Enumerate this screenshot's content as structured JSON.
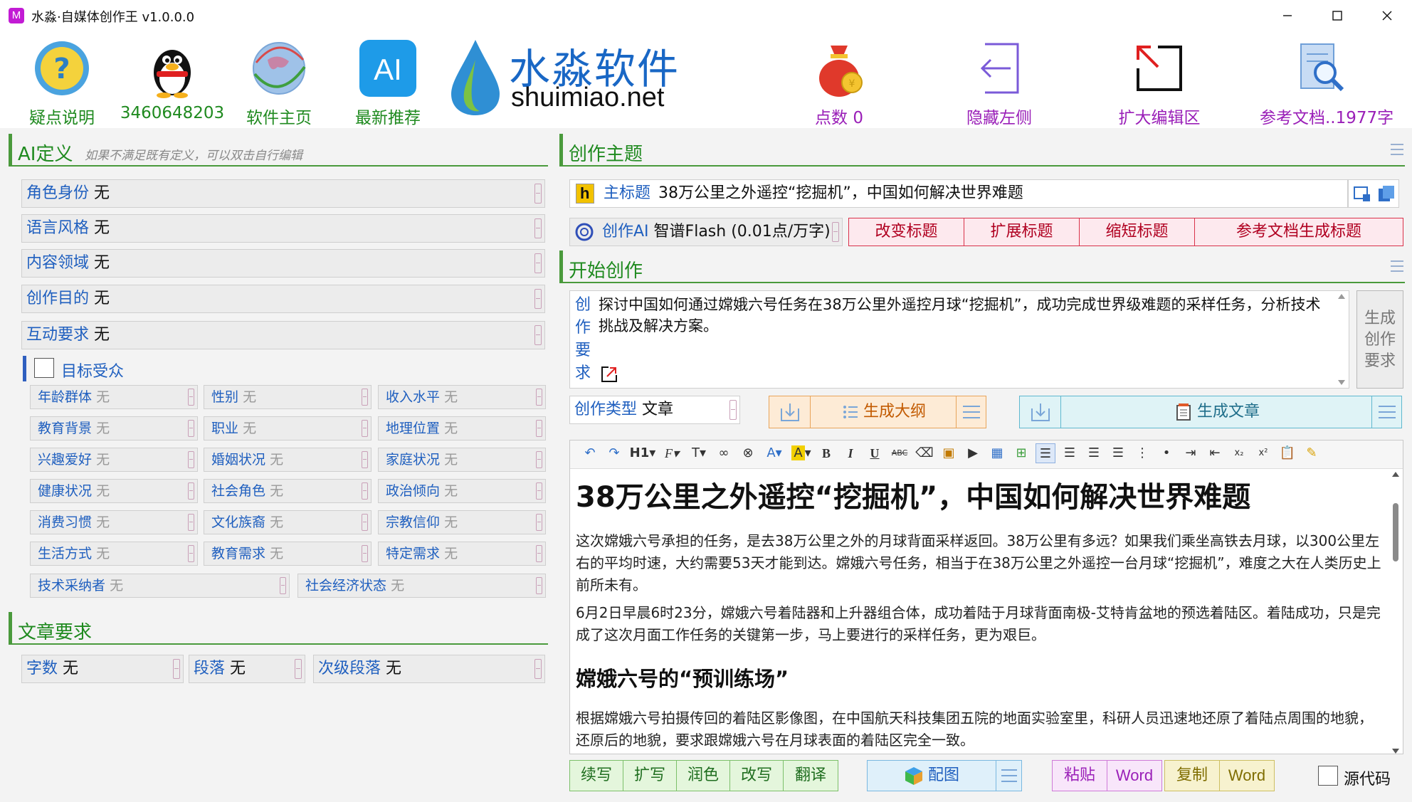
{
  "window": {
    "title": "水淼·自媒体创作王 v1.0.0.0",
    "icon_letter": "M"
  },
  "toolbar": {
    "faq": "疑点说明",
    "qq": "3460648203",
    "homepage": "软件主页",
    "ai_recommend": "最新推荐",
    "ai_icon_text": "AI",
    "logo_cn": "水淼软件",
    "logo_en": "shuimiao.net",
    "points": "点数 0",
    "hide_left": "隐藏左侧",
    "expand_editor": "扩大编辑区",
    "ref_docs": "参考文档..1977字"
  },
  "ai_def": {
    "title": "AI定义",
    "hint": "如果不满足既有定义，可以双击自行编辑",
    "fields": [
      {
        "k": "角色身份",
        "v": "无"
      },
      {
        "k": "语言风格",
        "v": "无"
      },
      {
        "k": "内容领域",
        "v": "无"
      },
      {
        "k": "创作目的",
        "v": "无"
      },
      {
        "k": "互动要求",
        "v": "无"
      }
    ],
    "audience_label": "目标受众",
    "audience": [
      {
        "k": "年龄群体",
        "v": "无"
      },
      {
        "k": "性别",
        "v": "无"
      },
      {
        "k": "收入水平",
        "v": "无"
      },
      {
        "k": "教育背景",
        "v": "无"
      },
      {
        "k": "职业",
        "v": "无"
      },
      {
        "k": "地理位置",
        "v": "无"
      },
      {
        "k": "兴趣爱好",
        "v": "无"
      },
      {
        "k": "婚姻状况",
        "v": "无"
      },
      {
        "k": "家庭状况",
        "v": "无"
      },
      {
        "k": "健康状况",
        "v": "无"
      },
      {
        "k": "社会角色",
        "v": "无"
      },
      {
        "k": "政治倾向",
        "v": "无"
      },
      {
        "k": "消费习惯",
        "v": "无"
      },
      {
        "k": "文化族裔",
        "v": "无"
      },
      {
        "k": "宗教信仰",
        "v": "无"
      },
      {
        "k": "生活方式",
        "v": "无"
      },
      {
        "k": "教育需求",
        "v": "无"
      },
      {
        "k": "特定需求",
        "v": "无"
      },
      {
        "k": "技术采纳者",
        "v": "无"
      },
      {
        "k": "社会经济状态",
        "v": "无"
      }
    ]
  },
  "article_req": {
    "title": "文章要求",
    "fields": [
      {
        "k": "字数",
        "v": "无"
      },
      {
        "k": "段落",
        "v": "无"
      },
      {
        "k": "次级段落",
        "v": "无"
      }
    ]
  },
  "topic": {
    "title": "创作主题",
    "main_title_label": "主标题",
    "main_title_value": "38万公里之外遥控“挖掘机”，中国如何解决世界难题",
    "ai_label": "创作AI",
    "ai_value": "智谱Flash (0.01点/万字)",
    "buttons": [
      "改变标题",
      "扩展标题",
      "缩短标题",
      "参考文档生成标题"
    ]
  },
  "create": {
    "title": "开始创作",
    "req_label": [
      "创",
      "作",
      "要",
      "求"
    ],
    "req_text": "探讨中国如何通过嫦娥六号任务在38万公里外遥控月球“挖掘机”，成功完成世界级难题的采样任务，分析技术挑战及解决方案。",
    "gen_req": [
      "生成",
      "创作",
      "要求"
    ],
    "type_label": "创作类型",
    "type_value": "文章",
    "outline_btn": "生成大纲",
    "article_btn": "生成文章"
  },
  "editor": {
    "toolbar": {
      "h1": "H1",
      "font": "F",
      "size": "T",
      "bold": "B",
      "italic": "I",
      "underline": "U",
      "strike": "ABC"
    },
    "h1": "38万公里之外遥控“挖掘机”，中国如何解决世界难题",
    "p1": "这次嫦娥六号承担的任务，是去38万公里之外的月球背面采样返回。38万公里有多远？如果我们乘坐高铁去月球，以300公里左右的平均时速，大约需要53天才能到达。嫦娥六号任务，相当于在38万公里之外遥控一台月球“挖掘机”，难度之大在人类历史上前所未有。",
    "p2": "6月2日早晨6时23分，嫦娥六号着陆器和上升器组合体，成功着陆于月球背面南极-艾特肯盆地的预选着陆区。着陆成功，只是完成了这次月面工作任务的关键第一步，马上要进行的采样任务，更为艰巨。",
    "h2": "嫦娥六号的“预训练场”",
    "p3": "根据嫦娥六号拍摄传回的着陆区影像图，在中国航天科技集团五院的地面实验室里，科研人员迅速地还原了着陆点周围的地貌，还原后的地貌，要求跟嫦娥六号在月球表面的着陆区完全一致。"
  },
  "bottom": {
    "green": [
      "续写",
      "扩写",
      "润色",
      "改写",
      "翻译"
    ],
    "match": "配图",
    "paste": "粘贴",
    "paste_word": "Word",
    "copy": "复制",
    "copy_word": "Word",
    "source": "源代码"
  }
}
